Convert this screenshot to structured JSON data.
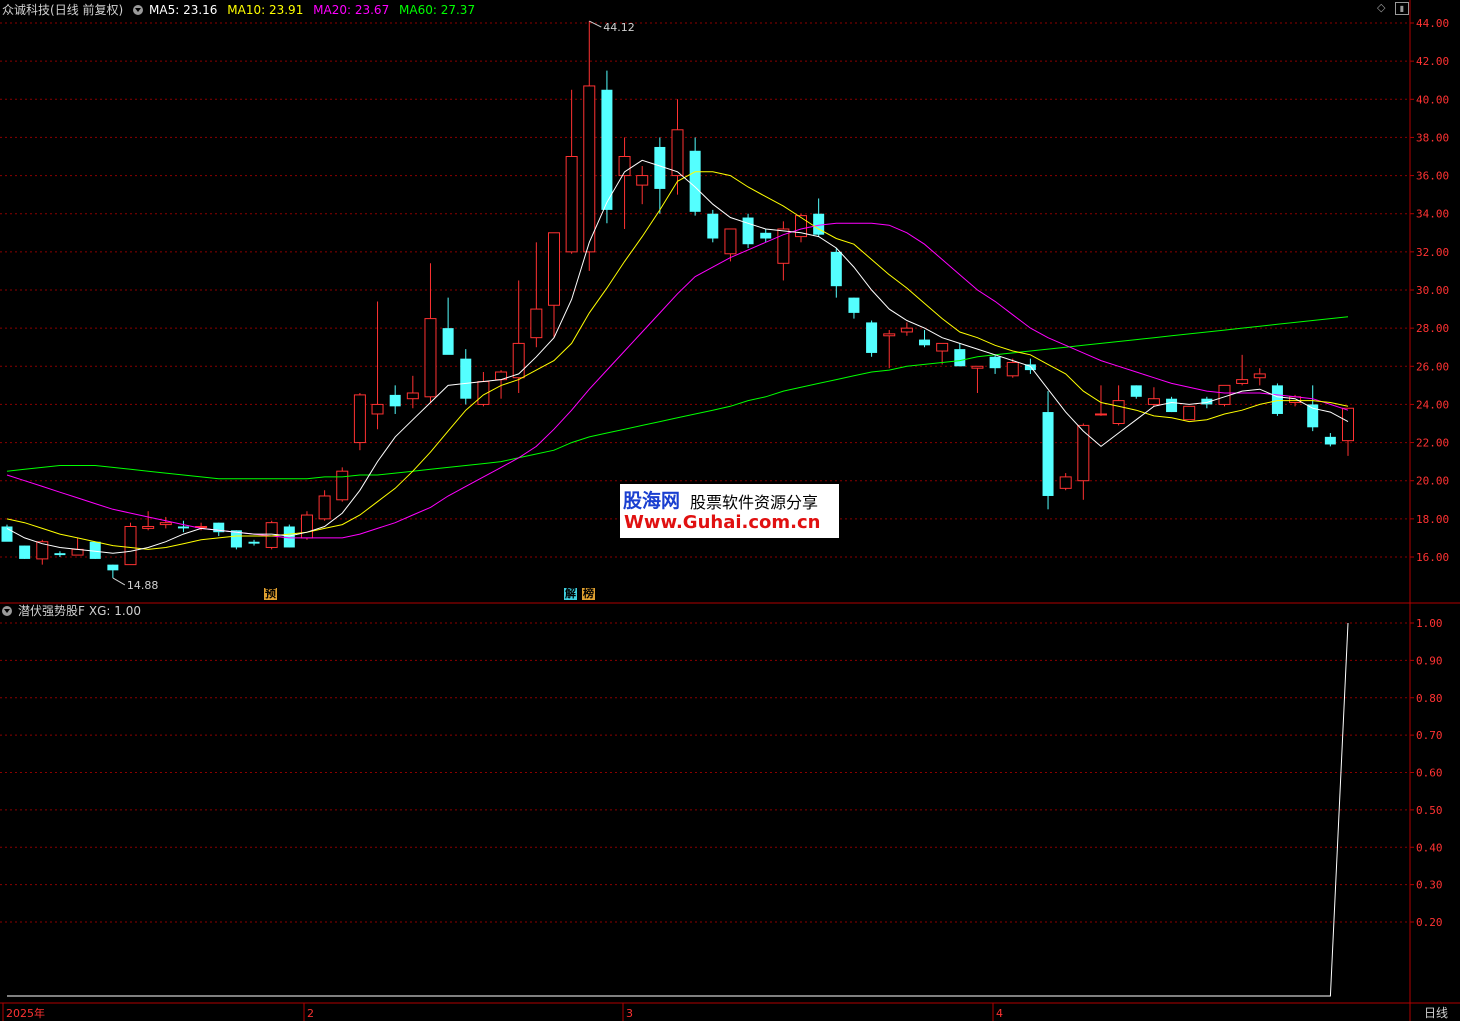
{
  "header": {
    "stock_name": "众诚科技",
    "mode": "(日线 前复权)",
    "ma5": "MA5: 23.16",
    "ma10": "MA10: 23.91",
    "ma20": "MA20: 23.67",
    "ma60": "MA60: 27.37"
  },
  "indicator_header": {
    "name": "潜伏强势股F",
    "xg": "XG: 1.00"
  },
  "price_axis": [
    "44.00",
    "42.00",
    "40.00",
    "38.00",
    "36.00",
    "34.00",
    "32.00",
    "30.00",
    "28.00",
    "26.00",
    "24.00",
    "22.00",
    "20.00",
    "18.00",
    "16.00"
  ],
  "indicator_axis": [
    "1.00",
    "0.90",
    "0.80",
    "0.70",
    "0.60",
    "0.50",
    "0.40",
    "0.30",
    "0.20"
  ],
  "date_axis": [
    "2025年",
    "2",
    "3",
    "4"
  ],
  "period_button": "日线",
  "high_label": "44.12",
  "low_label": "14.88",
  "event_tags": [
    "预",
    "解",
    "榜"
  ],
  "watermark": {
    "line1": "股海网",
    "line2": "股票软件资源分享",
    "line3": "Www.Guhai.com.cn"
  },
  "colors": {
    "up": "#ff3232",
    "down": "#54ffff",
    "ma5": "#ffffff",
    "ma10": "#ffff00",
    "ma20": "#ff00ff",
    "ma60": "#00ff00",
    "grid": "#8b0000"
  },
  "chart_data": {
    "type": "candlestick",
    "candles": [
      [
        17.6,
        17.7,
        16.9,
        16.8
      ],
      [
        16.6,
        16.6,
        15.9,
        15.9
      ],
      [
        15.9,
        16.9,
        15.6,
        16.8
      ],
      [
        16.2,
        16.3,
        16.0,
        16.1
      ],
      [
        16.1,
        17.0,
        16.1,
        16.4
      ],
      [
        16.8,
        16.8,
        15.9,
        15.9
      ],
      [
        15.6,
        15.6,
        14.9,
        15.3
      ],
      [
        15.6,
        17.8,
        15.6,
        17.6
      ],
      [
        17.5,
        18.4,
        17.4,
        17.6
      ],
      [
        17.7,
        18.1,
        17.5,
        17.8
      ],
      [
        17.6,
        17.9,
        17.3,
        17.5
      ],
      [
        17.6,
        17.8,
        17.4,
        17.6
      ],
      [
        17.8,
        17.8,
        17.1,
        17.3
      ],
      [
        17.4,
        17.4,
        16.4,
        16.5
      ],
      [
        16.8,
        16.9,
        16.6,
        16.7
      ],
      [
        16.5,
        17.9,
        16.4,
        17.8
      ],
      [
        17.6,
        17.7,
        16.5,
        16.5
      ],
      [
        17.0,
        18.4,
        16.9,
        18.2
      ],
      [
        18.0,
        19.5,
        17.9,
        19.2
      ],
      [
        19.0,
        20.7,
        18.9,
        20.5
      ],
      [
        22.0,
        24.6,
        21.6,
        24.5
      ],
      [
        23.5,
        29.4,
        22.7,
        24.0
      ],
      [
        24.5,
        25.0,
        23.5,
        23.9
      ],
      [
        24.3,
        25.5,
        23.8,
        24.6
      ],
      [
        24.4,
        31.4,
        24.1,
        28.5
      ],
      [
        28.0,
        29.6,
        26.7,
        26.6
      ],
      [
        26.4,
        26.9,
        24.0,
        24.3
      ],
      [
        24.0,
        25.7,
        23.9,
        25.2
      ],
      [
        25.3,
        25.8,
        24.3,
        25.7
      ],
      [
        25.4,
        30.5,
        24.6,
        27.2
      ],
      [
        27.5,
        32.5,
        27.0,
        29.0
      ],
      [
        29.2,
        33.0,
        27.5,
        33.0
      ],
      [
        32.0,
        40.5,
        31.9,
        37.0
      ],
      [
        32.0,
        44.1,
        31.0,
        40.7
      ],
      [
        40.5,
        41.5,
        33.5,
        34.2
      ],
      [
        36.0,
        38.0,
        33.2,
        37.0
      ],
      [
        35.5,
        36.5,
        34.5,
        36.0
      ],
      [
        37.5,
        38.0,
        34.0,
        35.3
      ],
      [
        36.0,
        40.0,
        35.0,
        38.4
      ],
      [
        37.3,
        38.0,
        33.9,
        34.1
      ],
      [
        34.0,
        34.2,
        32.5,
        32.7
      ],
      [
        31.9,
        33.2,
        31.5,
        33.2
      ],
      [
        33.8,
        34.0,
        32.2,
        32.4
      ],
      [
        33.0,
        33.2,
        32.5,
        32.7
      ],
      [
        31.4,
        33.6,
        30.5,
        33.2
      ],
      [
        32.8,
        34.0,
        32.5,
        33.9
      ],
      [
        34.0,
        34.8,
        32.8,
        32.9
      ],
      [
        32.0,
        32.2,
        29.6,
        30.2
      ],
      [
        29.6,
        29.6,
        28.5,
        28.8
      ],
      [
        28.3,
        28.4,
        26.5,
        26.7
      ],
      [
        27.6,
        27.9,
        25.9,
        27.7
      ],
      [
        27.8,
        28.3,
        27.6,
        28.0
      ],
      [
        27.4,
        27.9,
        27.0,
        27.1
      ],
      [
        26.8,
        27.2,
        26.1,
        27.2
      ],
      [
        26.9,
        27.2,
        26.0,
        26.0
      ],
      [
        25.9,
        26.0,
        24.6,
        26.0
      ],
      [
        26.5,
        26.6,
        25.6,
        25.9
      ],
      [
        25.5,
        26.4,
        25.4,
        26.2
      ],
      [
        26.1,
        26.4,
        25.6,
        25.8
      ],
      [
        23.6,
        24.7,
        18.5,
        19.2
      ],
      [
        19.6,
        20.4,
        19.5,
        20.2
      ],
      [
        20.0,
        23.0,
        19.0,
        22.9
      ],
      [
        23.5,
        25.0,
        23.4,
        23.5
      ],
      [
        23.0,
        25.0,
        22.9,
        24.2
      ],
      [
        25.0,
        25.0,
        24.3,
        24.4
      ],
      [
        24.0,
        24.9,
        23.9,
        24.3
      ],
      [
        24.3,
        24.4,
        23.6,
        23.6
      ],
      [
        23.2,
        23.9,
        23.2,
        23.9
      ],
      [
        24.3,
        24.4,
        23.8,
        24.0
      ],
      [
        24.0,
        25.0,
        23.9,
        25.0
      ],
      [
        25.1,
        26.6,
        25.0,
        25.3
      ],
      [
        25.4,
        25.9,
        25.0,
        25.6
      ],
      [
        25.0,
        25.1,
        23.4,
        23.5
      ],
      [
        24.1,
        24.5,
        23.9,
        24.4
      ],
      [
        24.0,
        25.0,
        22.6,
        22.8
      ],
      [
        22.3,
        22.5,
        21.8,
        21.9
      ],
      [
        22.1,
        23.8,
        21.3,
        23.8
      ]
    ],
    "ma5": [
      17.5,
      17.0,
      16.7,
      16.5,
      16.4,
      16.3,
      16.2,
      16.3,
      16.5,
      16.8,
      17.2,
      17.5,
      17.4,
      17.3,
      17.2,
      17.2,
      17.1,
      17.3,
      17.6,
      18.3,
      19.5,
      21.0,
      22.3,
      23.2,
      24.1,
      25.0,
      25.1,
      25.2,
      25.3,
      25.6,
      26.5,
      27.5,
      29.5,
      32.5,
      34.6,
      36.2,
      36.8,
      36.5,
      36.2,
      35.4,
      34.5,
      33.8,
      33.5,
      33.2,
      33.1,
      33.0,
      32.8,
      32.2,
      31.2,
      30.0,
      29.0,
      28.4,
      28.0,
      27.5,
      27.2,
      26.9,
      26.6,
      26.3,
      26.0,
      24.8,
      23.6,
      22.6,
      21.8,
      22.5,
      23.2,
      23.9,
      24.1,
      24.0,
      24.1,
      24.4,
      24.7,
      24.8,
      24.4,
      24.3,
      23.8,
      23.6,
      23.1
    ],
    "ma10": [
      18.0,
      17.8,
      17.5,
      17.2,
      17.0,
      16.8,
      16.6,
      16.5,
      16.4,
      16.5,
      16.7,
      16.9,
      17.0,
      17.1,
      17.1,
      17.1,
      17.2,
      17.3,
      17.5,
      17.7,
      18.2,
      18.9,
      19.6,
      20.5,
      21.5,
      22.6,
      23.7,
      24.5,
      25.0,
      25.3,
      25.8,
      26.3,
      27.2,
      28.8,
      30.1,
      31.5,
      32.8,
      34.2,
      35.7,
      36.2,
      36.2,
      36.0,
      35.4,
      34.9,
      34.4,
      33.8,
      33.2,
      32.7,
      32.4,
      31.6,
      30.8,
      30.1,
      29.3,
      28.5,
      27.8,
      27.5,
      27.1,
      26.8,
      26.6,
      26.1,
      25.6,
      24.7,
      24.1,
      23.9,
      23.7,
      23.4,
      23.3,
      23.1,
      23.2,
      23.5,
      23.7,
      24.0,
      24.2,
      24.2,
      24.2,
      24.1,
      23.9
    ],
    "ma20": [
      20.3,
      20.0,
      19.7,
      19.4,
      19.1,
      18.8,
      18.5,
      18.3,
      18.1,
      17.9,
      17.7,
      17.5,
      17.4,
      17.3,
      17.2,
      17.1,
      17.0,
      17.0,
      17.0,
      17.0,
      17.2,
      17.5,
      17.8,
      18.2,
      18.6,
      19.2,
      19.7,
      20.2,
      20.7,
      21.2,
      21.8,
      22.7,
      23.7,
      24.8,
      25.8,
      26.8,
      27.8,
      28.8,
      29.8,
      30.7,
      31.2,
      31.7,
      32.1,
      32.5,
      32.9,
      33.2,
      33.4,
      33.5,
      33.5,
      33.5,
      33.4,
      33.0,
      32.4,
      31.6,
      30.8,
      30.0,
      29.4,
      28.7,
      28.0,
      27.5,
      27.1,
      26.7,
      26.3,
      26.0,
      25.7,
      25.4,
      25.1,
      24.9,
      24.7,
      24.6,
      24.6,
      24.6,
      24.5,
      24.4,
      24.3,
      24.0,
      23.7
    ],
    "ma60": [
      20.5,
      20.6,
      20.7,
      20.8,
      20.8,
      20.8,
      20.7,
      20.6,
      20.5,
      20.4,
      20.3,
      20.2,
      20.1,
      20.1,
      20.1,
      20.1,
      20.1,
      20.1,
      20.2,
      20.2,
      20.3,
      20.3,
      20.4,
      20.5,
      20.6,
      20.7,
      20.8,
      20.9,
      21.0,
      21.2,
      21.4,
      21.6,
      22.0,
      22.3,
      22.5,
      22.7,
      22.9,
      23.1,
      23.3,
      23.5,
      23.7,
      23.9,
      24.2,
      24.4,
      24.7,
      24.9,
      25.1,
      25.3,
      25.5,
      25.7,
      25.8,
      26.0,
      26.1,
      26.2,
      26.3,
      26.5,
      26.6,
      26.7,
      26.8,
      26.9,
      27.0,
      27.1,
      27.2,
      27.3,
      27.4,
      27.5,
      27.6,
      27.7,
      27.8,
      27.9,
      28.0,
      28.1,
      28.2,
      28.3,
      28.4,
      28.5,
      28.6
    ],
    "xg": [
      0,
      0,
      0,
      0,
      0,
      0,
      0,
      0,
      0,
      0,
      0,
      0,
      0,
      0,
      0,
      0,
      0,
      0,
      0,
      0,
      0,
      0,
      0,
      0,
      0,
      0,
      0,
      0,
      0,
      0,
      0,
      0,
      0,
      0,
      0,
      0,
      0,
      0,
      0,
      0,
      0,
      0,
      0,
      0,
      0,
      0,
      0,
      0,
      0,
      0,
      0,
      0,
      0,
      0,
      0,
      0,
      0,
      0,
      0,
      0,
      0,
      0,
      0,
      0,
      0,
      0,
      0,
      0,
      0,
      0,
      0,
      0,
      0,
      0,
      0,
      0,
      1
    ],
    "price_ylim": [
      14.0,
      45.0
    ],
    "indicator_ylim": [
      0,
      1.0
    ]
  }
}
